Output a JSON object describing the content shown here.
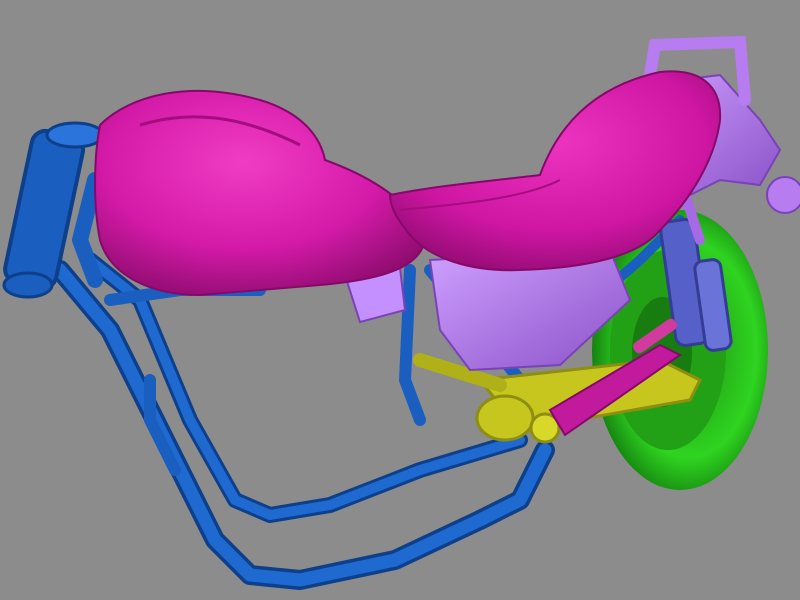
{
  "scene": {
    "subject": "motorcycle-frame-3d-render",
    "background_color": "#8c8c8c",
    "colors": {
      "frame": "#1a5fbf",
      "frame_dark": "#0e3f8a",
      "seat": "#d41aa8",
      "seat_dark": "#9c0f7a",
      "fender_panel": "#b77cf0",
      "fender_panel_dark": "#8a52c8",
      "tire": "#27c41a",
      "tire_dark": "#178a10",
      "swingarm": "#c6c61e",
      "swingarm_dark": "#8e8e10",
      "shock": "#5560c8"
    }
  }
}
